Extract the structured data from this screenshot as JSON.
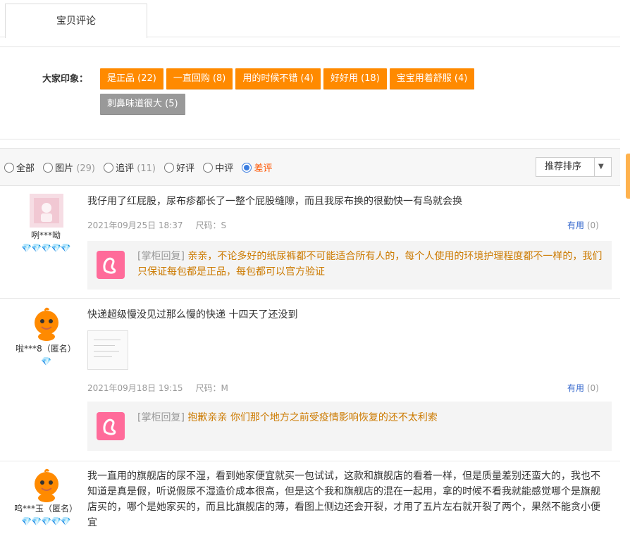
{
  "tab": {
    "label": "宝贝评论"
  },
  "impressions": {
    "label": "大家印象：",
    "tags": [
      {
        "text": "是正品 (22)",
        "color": "#ff8a00"
      },
      {
        "text": "一直回购 (8)",
        "color": "#ff8a00"
      },
      {
        "text": "用的时候不错 (4)",
        "color": "#ff8a00"
      },
      {
        "text": "好好用 (18)",
        "color": "#ff8a00"
      },
      {
        "text": "宝宝用着舒服 (4)",
        "color": "#ff8a00"
      },
      {
        "text": "刺鼻味道很大 (5)",
        "color": "#999999"
      }
    ]
  },
  "filters": {
    "options": [
      {
        "label": "全部",
        "count": "",
        "selected": false
      },
      {
        "label": "图片",
        "count": "(29)",
        "selected": false
      },
      {
        "label": "追评",
        "count": "(11)",
        "selected": false
      },
      {
        "label": "好评",
        "count": "",
        "selected": false
      },
      {
        "label": "中评",
        "count": "",
        "selected": false
      },
      {
        "label": "差评",
        "count": "",
        "selected": true
      }
    ],
    "sort_label": "推荐排序"
  },
  "reviews": [
    {
      "user": "咧***呦",
      "gems": "💎💎💎💎💎",
      "content": "我仔用了红屁股，尿布疹都长了一整个屁股缝隙，而且我尿布换的很勤快一有鸟就会换",
      "date": "2021年09月25日 18:37",
      "size": "尺码：S",
      "useful_label": "有用",
      "useful_count": "(0)",
      "reply_prefix": "[掌柜回复]",
      "reply": "亲亲，不论多好的纸尿裤都不可能适合所有人的，每个人使用的环境护理程度都不一样的，我们只保证每包都是正品，每包都可以官方验证"
    },
    {
      "user": "啦***8（匿名）",
      "gems": "💎",
      "content": "快递超级慢没见过那么慢的快递 十四天了还没到",
      "date": "2021年09月18日 19:15",
      "size": "尺码：M",
      "useful_label": "有用",
      "useful_count": "(0)",
      "reply_prefix": "[掌柜回复]",
      "reply": "抱歉亲亲 你们那个地方之前受疫情影响恢复的还不太利索"
    },
    {
      "user": "呜***玉（匿名）",
      "gems": "💎💎💎💎💎",
      "content": "我一直用的旗舰店的尿不湿，看到她家便宜就买一包试试，这款和旗舰店的看着一样，但是质量差别还蛮大的，我也不知道是真是假，听说假尿不湿造价成本很高，但是这个我和旗舰店的混在一起用，拿的时候不看我就能感觉哪个是旗舰店买的，哪个是她家买的，而且比旗舰店的薄，看图上侧边还会开裂，才用了五片左右就开裂了两个，果然不能贪小便宜"
    }
  ]
}
